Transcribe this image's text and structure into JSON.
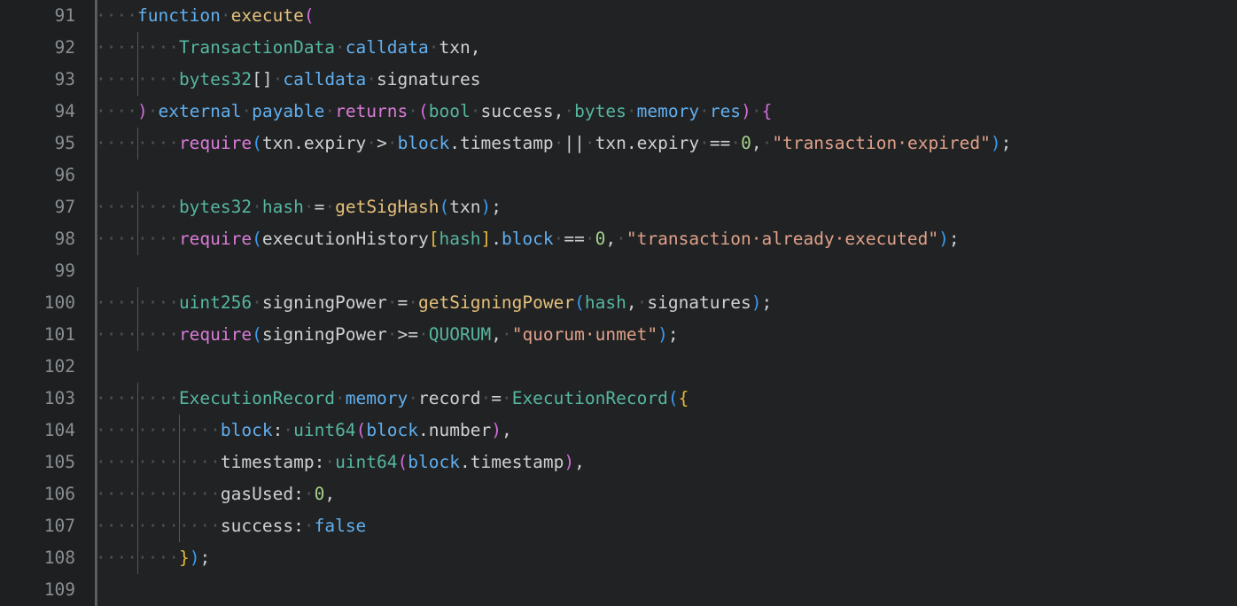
{
  "editor": {
    "language": "solidity",
    "theme": "one-dark",
    "whitespace_marker": "·",
    "colors": {
      "background": "#212223",
      "gutter_background": "#1e1f20",
      "gutter_separator": "#5c5f61",
      "line_number": "#888e92",
      "indent_guide": "#545759",
      "whitespace_dot": "#4d5052",
      "keyword": "#61afef",
      "function_name": "#e5c07b",
      "type": "#56b6a0",
      "plain_text": "#cdd1d3",
      "paren_blue": "#3b9bf0",
      "paren_magenta": "#d26ddc",
      "brace_yellow": "#e5b83b",
      "control": "#d87bd8",
      "string": "#e0a18a",
      "number": "#a3d38a"
    },
    "first_line_number": 91,
    "last_line_number": 109,
    "line_numbers": [
      91,
      92,
      93,
      94,
      95,
      96,
      97,
      98,
      99,
      100,
      101,
      102,
      103,
      104,
      105,
      106,
      107,
      108,
      109
    ],
    "lines": [
      {
        "number": 91,
        "indent_dots": 4,
        "text": "    function execute(",
        "tokens": [
          {
            "t": "····",
            "c": "t-ws"
          },
          {
            "t": "function",
            "c": "t-kw"
          },
          {
            "t": "·",
            "c": "t-ws"
          },
          {
            "t": "execute",
            "c": "t-fn"
          },
          {
            "t": "(",
            "c": "t-paren-m"
          }
        ]
      },
      {
        "number": 92,
        "indent_dots": 8,
        "text": "        TransactionData calldata txn,",
        "tokens": [
          {
            "t": "····",
            "c": "t-ws"
          },
          {
            "t": "····",
            "c": "t-ws"
          },
          {
            "t": "TransactionData",
            "c": "t-type"
          },
          {
            "t": "·",
            "c": "t-ws"
          },
          {
            "t": "calldata",
            "c": "t-kw"
          },
          {
            "t": "·",
            "c": "t-ws"
          },
          {
            "t": "txn",
            "c": "t-plain"
          },
          {
            "t": ",",
            "c": "t-punc"
          }
        ]
      },
      {
        "number": 93,
        "indent_dots": 8,
        "text": "        bytes32[] calldata signatures",
        "tokens": [
          {
            "t": "····",
            "c": "t-ws"
          },
          {
            "t": "····",
            "c": "t-ws"
          },
          {
            "t": "bytes32",
            "c": "t-type"
          },
          {
            "t": "[]",
            "c": "t-plain"
          },
          {
            "t": "·",
            "c": "t-ws"
          },
          {
            "t": "calldata",
            "c": "t-kw"
          },
          {
            "t": "·",
            "c": "t-ws"
          },
          {
            "t": "signatures",
            "c": "t-plain"
          }
        ]
      },
      {
        "number": 94,
        "indent_dots": 4,
        "text": "    ) external payable returns (bool success, bytes memory res) {",
        "tokens": [
          {
            "t": "····",
            "c": "t-ws"
          },
          {
            "t": ")",
            "c": "t-paren-m"
          },
          {
            "t": "·",
            "c": "t-ws"
          },
          {
            "t": "external",
            "c": "t-kw"
          },
          {
            "t": "·",
            "c": "t-ws"
          },
          {
            "t": "payable",
            "c": "t-kw"
          },
          {
            "t": "·",
            "c": "t-ws"
          },
          {
            "t": "returns",
            "c": "t-ctrl"
          },
          {
            "t": "·",
            "c": "t-ws"
          },
          {
            "t": "(",
            "c": "t-paren-m"
          },
          {
            "t": "bool",
            "c": "t-type"
          },
          {
            "t": "·",
            "c": "t-ws"
          },
          {
            "t": "success",
            "c": "t-plain"
          },
          {
            "t": ",",
            "c": "t-punc"
          },
          {
            "t": "·",
            "c": "t-ws"
          },
          {
            "t": "bytes",
            "c": "t-type"
          },
          {
            "t": "·",
            "c": "t-ws"
          },
          {
            "t": "memory",
            "c": "t-kw"
          },
          {
            "t": "·",
            "c": "t-ws"
          },
          {
            "t": "res",
            "c": "t-kw"
          },
          {
            "t": ")",
            "c": "t-paren-m"
          },
          {
            "t": "·",
            "c": "t-ws"
          },
          {
            "t": "{",
            "c": "t-paren-m"
          }
        ]
      },
      {
        "number": 95,
        "indent_dots": 8,
        "text": "        require(txn.expiry > block.timestamp || txn.expiry == 0, \"transaction expired\");",
        "tokens": [
          {
            "t": "····",
            "c": "t-ws"
          },
          {
            "t": "····",
            "c": "t-ws"
          },
          {
            "t": "require",
            "c": "t-ctrl"
          },
          {
            "t": "(",
            "c": "t-paren-b"
          },
          {
            "t": "txn",
            "c": "t-plain"
          },
          {
            "t": ".",
            "c": "t-punc"
          },
          {
            "t": "expiry",
            "c": "t-plain"
          },
          {
            "t": "·",
            "c": "t-ws"
          },
          {
            "t": ">",
            "c": "t-op"
          },
          {
            "t": "·",
            "c": "t-ws"
          },
          {
            "t": "block",
            "c": "t-kw"
          },
          {
            "t": ".",
            "c": "t-punc"
          },
          {
            "t": "timestamp",
            "c": "t-plain"
          },
          {
            "t": "·",
            "c": "t-ws"
          },
          {
            "t": "||",
            "c": "t-op"
          },
          {
            "t": "·",
            "c": "t-ws"
          },
          {
            "t": "txn",
            "c": "t-plain"
          },
          {
            "t": ".",
            "c": "t-punc"
          },
          {
            "t": "expiry",
            "c": "t-plain"
          },
          {
            "t": "·",
            "c": "t-ws"
          },
          {
            "t": "==",
            "c": "t-op"
          },
          {
            "t": "·",
            "c": "t-ws"
          },
          {
            "t": "0",
            "c": "t-num"
          },
          {
            "t": ",",
            "c": "t-punc"
          },
          {
            "t": "·",
            "c": "t-ws"
          },
          {
            "t": "\"transaction·expired\"",
            "c": "t-str"
          },
          {
            "t": ")",
            "c": "t-paren-b"
          },
          {
            "t": ";",
            "c": "t-punc"
          }
        ]
      },
      {
        "number": 96,
        "indent_dots": 0,
        "text": "",
        "tokens": []
      },
      {
        "number": 97,
        "indent_dots": 8,
        "text": "        bytes32 hash = getSigHash(txn);",
        "tokens": [
          {
            "t": "····",
            "c": "t-ws"
          },
          {
            "t": "····",
            "c": "t-ws"
          },
          {
            "t": "bytes32",
            "c": "t-type"
          },
          {
            "t": "·",
            "c": "t-ws"
          },
          {
            "t": "hash",
            "c": "t-type"
          },
          {
            "t": "·",
            "c": "t-ws"
          },
          {
            "t": "=",
            "c": "t-op"
          },
          {
            "t": "·",
            "c": "t-ws"
          },
          {
            "t": "getSigHash",
            "c": "t-fn"
          },
          {
            "t": "(",
            "c": "t-paren-b"
          },
          {
            "t": "txn",
            "c": "t-plain"
          },
          {
            "t": ")",
            "c": "t-paren-b"
          },
          {
            "t": ";",
            "c": "t-punc"
          }
        ]
      },
      {
        "number": 98,
        "indent_dots": 8,
        "text": "        require(executionHistory[hash].block == 0, \"transaction already executed\");",
        "tokens": [
          {
            "t": "····",
            "c": "t-ws"
          },
          {
            "t": "····",
            "c": "t-ws"
          },
          {
            "t": "require",
            "c": "t-ctrl"
          },
          {
            "t": "(",
            "c": "t-paren-b"
          },
          {
            "t": "executionHistory",
            "c": "t-plain"
          },
          {
            "t": "[",
            "c": "t-paren-y"
          },
          {
            "t": "hash",
            "c": "t-type"
          },
          {
            "t": "]",
            "c": "t-paren-y"
          },
          {
            "t": ".",
            "c": "t-punc"
          },
          {
            "t": "block",
            "c": "t-kw"
          },
          {
            "t": "·",
            "c": "t-ws"
          },
          {
            "t": "==",
            "c": "t-op"
          },
          {
            "t": "·",
            "c": "t-ws"
          },
          {
            "t": "0",
            "c": "t-num"
          },
          {
            "t": ",",
            "c": "t-punc"
          },
          {
            "t": "·",
            "c": "t-ws"
          },
          {
            "t": "\"transaction·already·executed\"",
            "c": "t-str"
          },
          {
            "t": ")",
            "c": "t-paren-b"
          },
          {
            "t": ";",
            "c": "t-punc"
          }
        ]
      },
      {
        "number": 99,
        "indent_dots": 0,
        "text": "",
        "tokens": []
      },
      {
        "number": 100,
        "indent_dots": 8,
        "text": "        uint256 signingPower = getSigningPower(hash, signatures);",
        "tokens": [
          {
            "t": "····",
            "c": "t-ws"
          },
          {
            "t": "····",
            "c": "t-ws"
          },
          {
            "t": "uint256",
            "c": "t-type"
          },
          {
            "t": "·",
            "c": "t-ws"
          },
          {
            "t": "signingPower",
            "c": "t-plain"
          },
          {
            "t": "·",
            "c": "t-ws"
          },
          {
            "t": "=",
            "c": "t-op"
          },
          {
            "t": "·",
            "c": "t-ws"
          },
          {
            "t": "getSigningPower",
            "c": "t-fn"
          },
          {
            "t": "(",
            "c": "t-paren-b"
          },
          {
            "t": "hash",
            "c": "t-type"
          },
          {
            "t": ",",
            "c": "t-punc"
          },
          {
            "t": "·",
            "c": "t-ws"
          },
          {
            "t": "signatures",
            "c": "t-plain"
          },
          {
            "t": ")",
            "c": "t-paren-b"
          },
          {
            "t": ";",
            "c": "t-punc"
          }
        ]
      },
      {
        "number": 101,
        "indent_dots": 8,
        "text": "        require(signingPower >= QUORUM, \"quorum unmet\");",
        "tokens": [
          {
            "t": "····",
            "c": "t-ws"
          },
          {
            "t": "····",
            "c": "t-ws"
          },
          {
            "t": "require",
            "c": "t-ctrl"
          },
          {
            "t": "(",
            "c": "t-paren-b"
          },
          {
            "t": "signingPower",
            "c": "t-plain"
          },
          {
            "t": "·",
            "c": "t-ws"
          },
          {
            "t": ">=",
            "c": "t-op"
          },
          {
            "t": "·",
            "c": "t-ws"
          },
          {
            "t": "QUORUM",
            "c": "t-const"
          },
          {
            "t": ",",
            "c": "t-punc"
          },
          {
            "t": "·",
            "c": "t-ws"
          },
          {
            "t": "\"quorum·unmet\"",
            "c": "t-str"
          },
          {
            "t": ")",
            "c": "t-paren-b"
          },
          {
            "t": ";",
            "c": "t-punc"
          }
        ]
      },
      {
        "number": 102,
        "indent_dots": 0,
        "text": "",
        "tokens": []
      },
      {
        "number": 103,
        "indent_dots": 8,
        "text": "        ExecutionRecord memory record = ExecutionRecord({",
        "tokens": [
          {
            "t": "····",
            "c": "t-ws"
          },
          {
            "t": "····",
            "c": "t-ws"
          },
          {
            "t": "ExecutionRecord",
            "c": "t-type"
          },
          {
            "t": "·",
            "c": "t-ws"
          },
          {
            "t": "memory",
            "c": "t-kw"
          },
          {
            "t": "·",
            "c": "t-ws"
          },
          {
            "t": "record",
            "c": "t-plain"
          },
          {
            "t": "·",
            "c": "t-ws"
          },
          {
            "t": "=",
            "c": "t-op"
          },
          {
            "t": "·",
            "c": "t-ws"
          },
          {
            "t": "ExecutionRecord",
            "c": "t-type"
          },
          {
            "t": "(",
            "c": "t-paren-b"
          },
          {
            "t": "{",
            "c": "t-paren-y"
          }
        ]
      },
      {
        "number": 104,
        "indent_dots": 12,
        "text": "            block: uint64(block.number),",
        "tokens": [
          {
            "t": "····",
            "c": "t-ws"
          },
          {
            "t": "····",
            "c": "t-ws"
          },
          {
            "t": "····",
            "c": "t-ws"
          },
          {
            "t": "block",
            "c": "t-kw"
          },
          {
            "t": ":",
            "c": "t-punc"
          },
          {
            "t": "·",
            "c": "t-ws"
          },
          {
            "t": "uint64",
            "c": "t-type"
          },
          {
            "t": "(",
            "c": "t-paren-m"
          },
          {
            "t": "block",
            "c": "t-kw"
          },
          {
            "t": ".",
            "c": "t-punc"
          },
          {
            "t": "number",
            "c": "t-plain"
          },
          {
            "t": ")",
            "c": "t-paren-m"
          },
          {
            "t": ",",
            "c": "t-punc"
          }
        ]
      },
      {
        "number": 105,
        "indent_dots": 12,
        "text": "            timestamp: uint64(block.timestamp),",
        "tokens": [
          {
            "t": "····",
            "c": "t-ws"
          },
          {
            "t": "····",
            "c": "t-ws"
          },
          {
            "t": "····",
            "c": "t-ws"
          },
          {
            "t": "timestamp",
            "c": "t-plain"
          },
          {
            "t": ":",
            "c": "t-punc"
          },
          {
            "t": "·",
            "c": "t-ws"
          },
          {
            "t": "uint64",
            "c": "t-type"
          },
          {
            "t": "(",
            "c": "t-paren-m"
          },
          {
            "t": "block",
            "c": "t-kw"
          },
          {
            "t": ".",
            "c": "t-punc"
          },
          {
            "t": "timestamp",
            "c": "t-plain"
          },
          {
            "t": ")",
            "c": "t-paren-m"
          },
          {
            "t": ",",
            "c": "t-punc"
          }
        ]
      },
      {
        "number": 106,
        "indent_dots": 12,
        "text": "            gasUsed: 0,",
        "tokens": [
          {
            "t": "····",
            "c": "t-ws"
          },
          {
            "t": "····",
            "c": "t-ws"
          },
          {
            "t": "····",
            "c": "t-ws"
          },
          {
            "t": "gasUsed",
            "c": "t-plain"
          },
          {
            "t": ":",
            "c": "t-punc"
          },
          {
            "t": "·",
            "c": "t-ws"
          },
          {
            "t": "0",
            "c": "t-num"
          },
          {
            "t": ",",
            "c": "t-punc"
          }
        ]
      },
      {
        "number": 107,
        "indent_dots": 12,
        "text": "            success: false",
        "tokens": [
          {
            "t": "····",
            "c": "t-ws"
          },
          {
            "t": "····",
            "c": "t-ws"
          },
          {
            "t": "····",
            "c": "t-ws"
          },
          {
            "t": "success",
            "c": "t-plain"
          },
          {
            "t": ":",
            "c": "t-punc"
          },
          {
            "t": "·",
            "c": "t-ws"
          },
          {
            "t": "false",
            "c": "t-kw"
          }
        ]
      },
      {
        "number": 108,
        "indent_dots": 8,
        "text": "        });",
        "tokens": [
          {
            "t": "····",
            "c": "t-ws"
          },
          {
            "t": "····",
            "c": "t-ws"
          },
          {
            "t": "}",
            "c": "t-paren-y"
          },
          {
            "t": ")",
            "c": "t-paren-b"
          },
          {
            "t": ";",
            "c": "t-punc"
          }
        ]
      },
      {
        "number": 109,
        "indent_dots": 0,
        "text": "",
        "tokens": []
      }
    ],
    "indent_guides": [
      {
        "column": 1,
        "from_line": 91,
        "to_line": 109
      },
      {
        "column": 2,
        "from_line": 92,
        "to_line": 93
      },
      {
        "column": 2,
        "from_line": 95,
        "to_line": 95
      },
      {
        "column": 2,
        "from_line": 97,
        "to_line": 98
      },
      {
        "column": 2,
        "from_line": 100,
        "to_line": 101
      },
      {
        "column": 2,
        "from_line": 103,
        "to_line": 108
      },
      {
        "column": 3,
        "from_line": 104,
        "to_line": 107
      }
    ]
  }
}
